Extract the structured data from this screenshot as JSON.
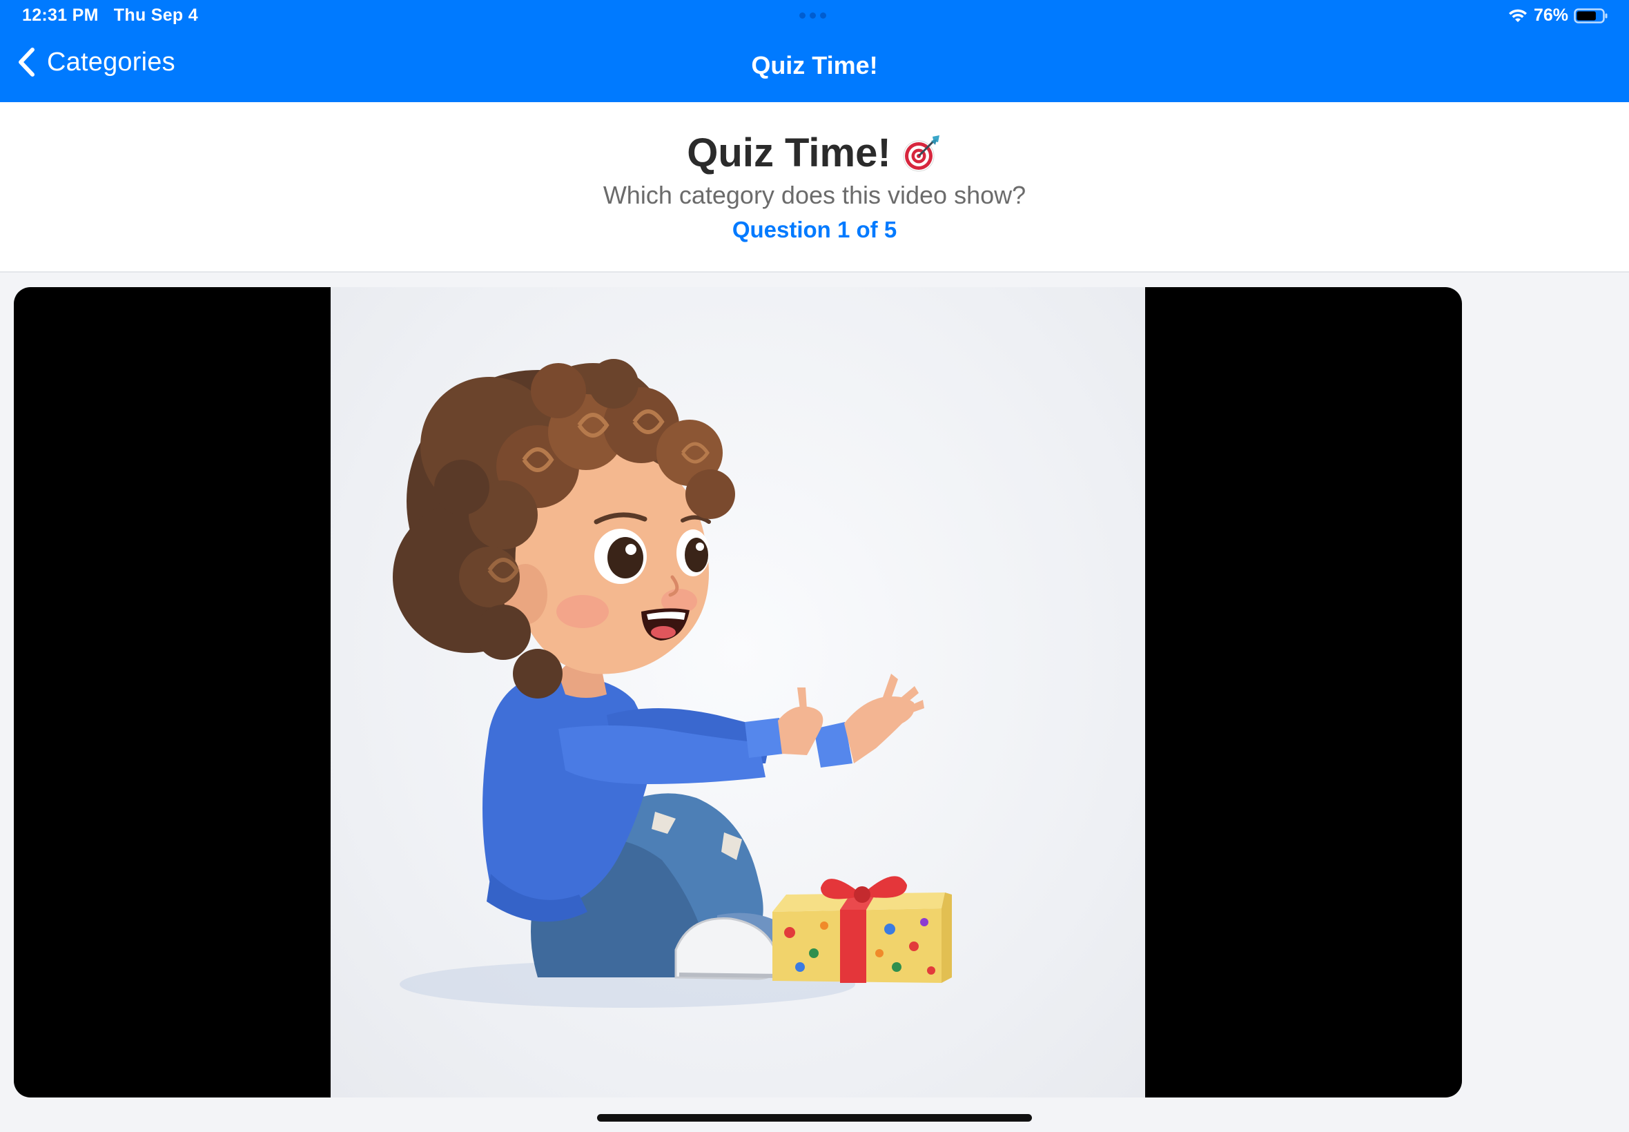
{
  "status_bar": {
    "time": "12:31 PM",
    "date": "Thu Sep 4",
    "battery_percent": "76%",
    "battery_level": 0.76,
    "wifi_icon": "wifi-icon",
    "battery_icon": "battery-icon"
  },
  "nav": {
    "back_label": "Categories",
    "back_icon": "chevron-left-icon",
    "title": "Quiz Time!"
  },
  "header": {
    "title": "Quiz Time!",
    "title_icon": "target-dart-icon",
    "subtitle": "Which category does this video show?",
    "progress": "Question 1 of 5",
    "progress_current": 1,
    "progress_total": 5
  },
  "video": {
    "content_icon": "child-with-gift-illustration"
  },
  "colors": {
    "accent": "#007aff",
    "title_text": "#2b2b2b",
    "subtitle_text": "#6b6b6b",
    "background": "#f3f4f7"
  }
}
